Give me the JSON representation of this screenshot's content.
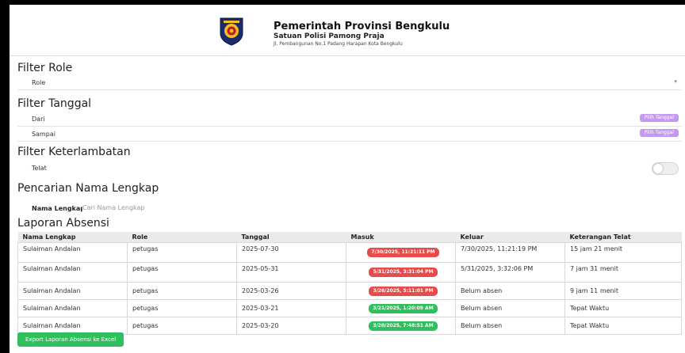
{
  "header": {
    "title": "Pemerintah Provinsi Bengkulu",
    "subtitle": "Satuan Polisi Pamong Praja",
    "address": "Jl. Pembangunan No.1 Padang Harapan Kota Bengkulu"
  },
  "filter_role": {
    "title": "Filter Role",
    "select_value": "Role"
  },
  "filter_tanggal": {
    "title": "Filter Tanggal",
    "from_label": "Dari",
    "to_label": "Sampai",
    "pick_button": "Pilih Tanggal"
  },
  "filter_late": {
    "title": "Filter Keterlambatan",
    "label": "Telat",
    "enabled": false
  },
  "search": {
    "title": "Pencarian Nama Lengkap",
    "label": "Nama Lengkap",
    "placeholder": "Cari Nama Lengkap",
    "value": ""
  },
  "report": {
    "title": "Laporan Absensi",
    "columns": [
      "Nama Lengkap",
      "Role",
      "Tanggal",
      "Masuk",
      "Keluar",
      "Keterangan Telat"
    ],
    "rows": [
      {
        "nama": "Sulaiman Andalan",
        "role": "petugas",
        "tanggal": "2025-07-30",
        "masuk": "7/30/2025, 11:21:11 PM",
        "masuk_status": "red",
        "keluar": "7/30/2025, 11:21:19 PM",
        "keterangan": "15 jam 21 menit"
      },
      {
        "nama": "Sulaiman Andalan",
        "role": "petugas",
        "tanggal": "2025-05-31",
        "masuk": "5/31/2025, 3:31:04 PM",
        "masuk_status": "red",
        "keluar": "5/31/2025, 3:32:06 PM",
        "keterangan": "7 jam 31 menit"
      },
      {
        "nama": "Sulaiman Andalan",
        "role": "petugas",
        "tanggal": "2025-03-26",
        "masuk": "3/26/2025, 5:11:01 PM",
        "masuk_status": "red",
        "keluar": "Belum absen",
        "keterangan": "9 jam 11 menit"
      },
      {
        "nama": "Sulaiman Andalan",
        "role": "petugas",
        "tanggal": "2025-03-21",
        "masuk": "3/21/2025, 1:20:09 AM",
        "masuk_status": "green",
        "keluar": "Belum absen",
        "keterangan": "Tepat Waktu"
      },
      {
        "nama": "Sulaiman Andalan",
        "role": "petugas",
        "tanggal": "2025-03-20",
        "masuk": "3/20/2025, 7:48:51 AM",
        "masuk_status": "green",
        "keluar": "Belum absen",
        "keterangan": "Tepat Waktu"
      }
    ]
  },
  "export_button": "Export Laporan Absensi ke Excel",
  "colors": {
    "late": "#e74b4b",
    "on_time": "#2fbf5d",
    "pick_button": "#c49af0"
  }
}
